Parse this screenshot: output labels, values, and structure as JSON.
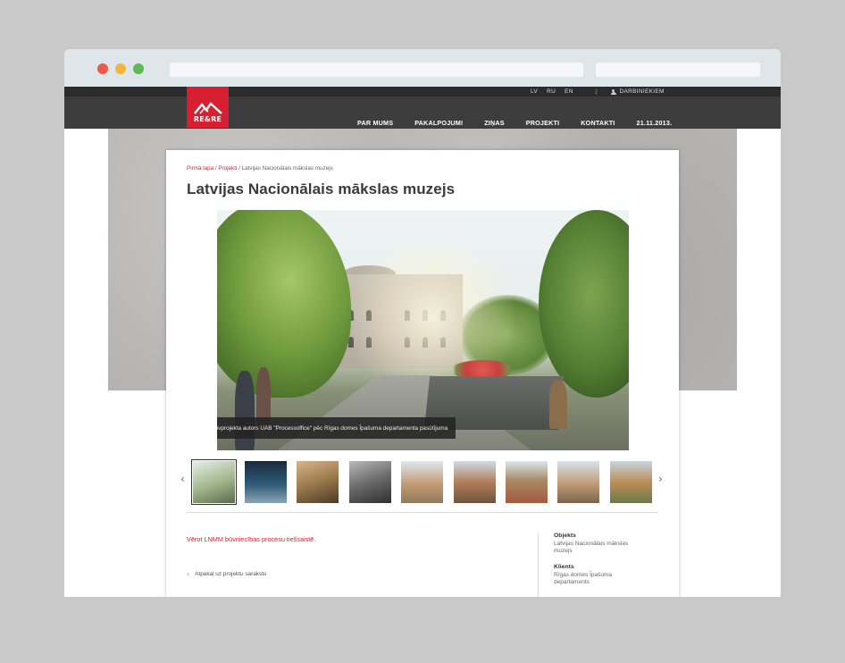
{
  "header": {
    "languages": [
      "LV",
      "RU",
      "EN"
    ],
    "employees_label": "DARBINIEKIEM",
    "logo_text": "RE&RE",
    "nav": [
      "PAR MUMS",
      "PAKALPOJUMI",
      "ZIŅAS",
      "PROJEKTI",
      "KONTAKTI"
    ],
    "date": "21.11.2013."
  },
  "breadcrumb": {
    "home": "Pirmā lapa",
    "section": "Projekti",
    "current": "Latvijas Nacionālais mākslas muzejs",
    "separator": " / "
  },
  "page": {
    "title": "Latvijas Nacionālais mākslas muzejs",
    "photo_caption": "Foto: Būvprojekta autors UAB \"Processoffice\" pēc Rīgas domes Īpašuma departamenta pasūtījuma",
    "live_link": "Vērot LNMM būvniecības procesu tiešsaistē.",
    "back_link": "Atpakaļ uz projektu sarakstu"
  },
  "thumbnails": {
    "prev": "‹",
    "next": "›",
    "count": 9,
    "selected_index": 0
  },
  "sidebar": {
    "items": [
      {
        "label": "Objekts",
        "value": "Latvijas Nacionālais mākslas muzejs"
      },
      {
        "label": "Klients",
        "value": "Rīgas domes Īpašuma departaments"
      }
    ]
  },
  "colors": {
    "accent": "#d71f31",
    "nav_bg": "#3d3d3d",
    "topbar_bg": "#2b2b2b"
  }
}
